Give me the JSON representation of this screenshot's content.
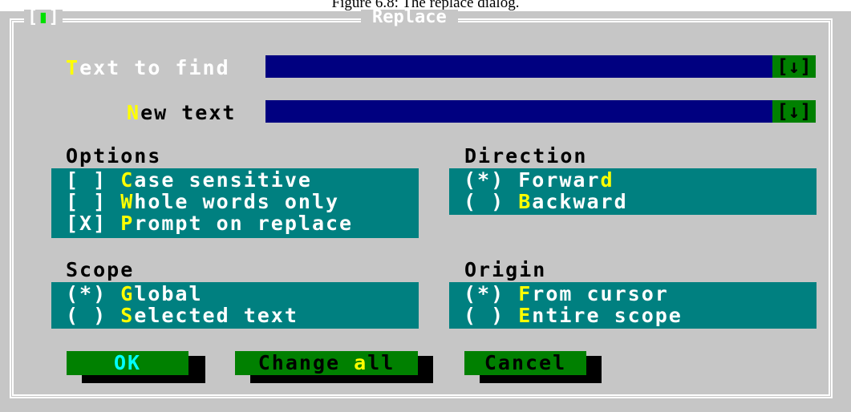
{
  "caption": "Figure 6.8: The replace dialog.",
  "dialog": {
    "title": "Replace",
    "close_glyph": "▮",
    "colors": {
      "frame_bg": "#c6c6c6",
      "input_bg": "#000080",
      "cluster_bg": "#008080",
      "button_bg": "#008000",
      "hotkey": "#ffff00"
    }
  },
  "find": {
    "label_hot": "T",
    "label_rest": "ext to find",
    "value": "",
    "history_glyph": "[↓]"
  },
  "replace": {
    "label_hot": "N",
    "label_rest": "ew text",
    "value": "",
    "history_glyph": "[↓]"
  },
  "options": {
    "title": "Options",
    "items": [
      {
        "mark": "[ ]",
        "hot": "C",
        "rest": "ase sensitive",
        "checked": false
      },
      {
        "mark": "[ ]",
        "hot": "W",
        "rest": "hole words only",
        "checked": false
      },
      {
        "mark": "[X]",
        "hot": "P",
        "rest": "rompt on replace",
        "checked": true
      }
    ]
  },
  "direction": {
    "title": "Direction",
    "items": [
      {
        "mark": "(*)",
        "pre": "Forwar",
        "hot": "d",
        "post": "",
        "selected": true
      },
      {
        "mark": "( )",
        "pre": "",
        "hot": "B",
        "post": "ackward",
        "selected": false
      }
    ]
  },
  "scope": {
    "title": "Scope",
    "items": [
      {
        "mark": "(*)",
        "hot": "G",
        "rest": "lobal",
        "selected": true
      },
      {
        "mark": "( )",
        "hot": "S",
        "rest": "elected text",
        "selected": false
      }
    ]
  },
  "origin": {
    "title": "Origin",
    "items": [
      {
        "mark": "(*)",
        "hot": "F",
        "rest": "rom cursor",
        "selected": true
      },
      {
        "mark": "( )",
        "hot": "E",
        "rest": "ntire scope",
        "selected": false
      }
    ]
  },
  "buttons": {
    "ok": "OK",
    "change_all_pre": "Change ",
    "change_all_hot": "a",
    "change_all_post": "ll",
    "cancel": "Cancel"
  }
}
